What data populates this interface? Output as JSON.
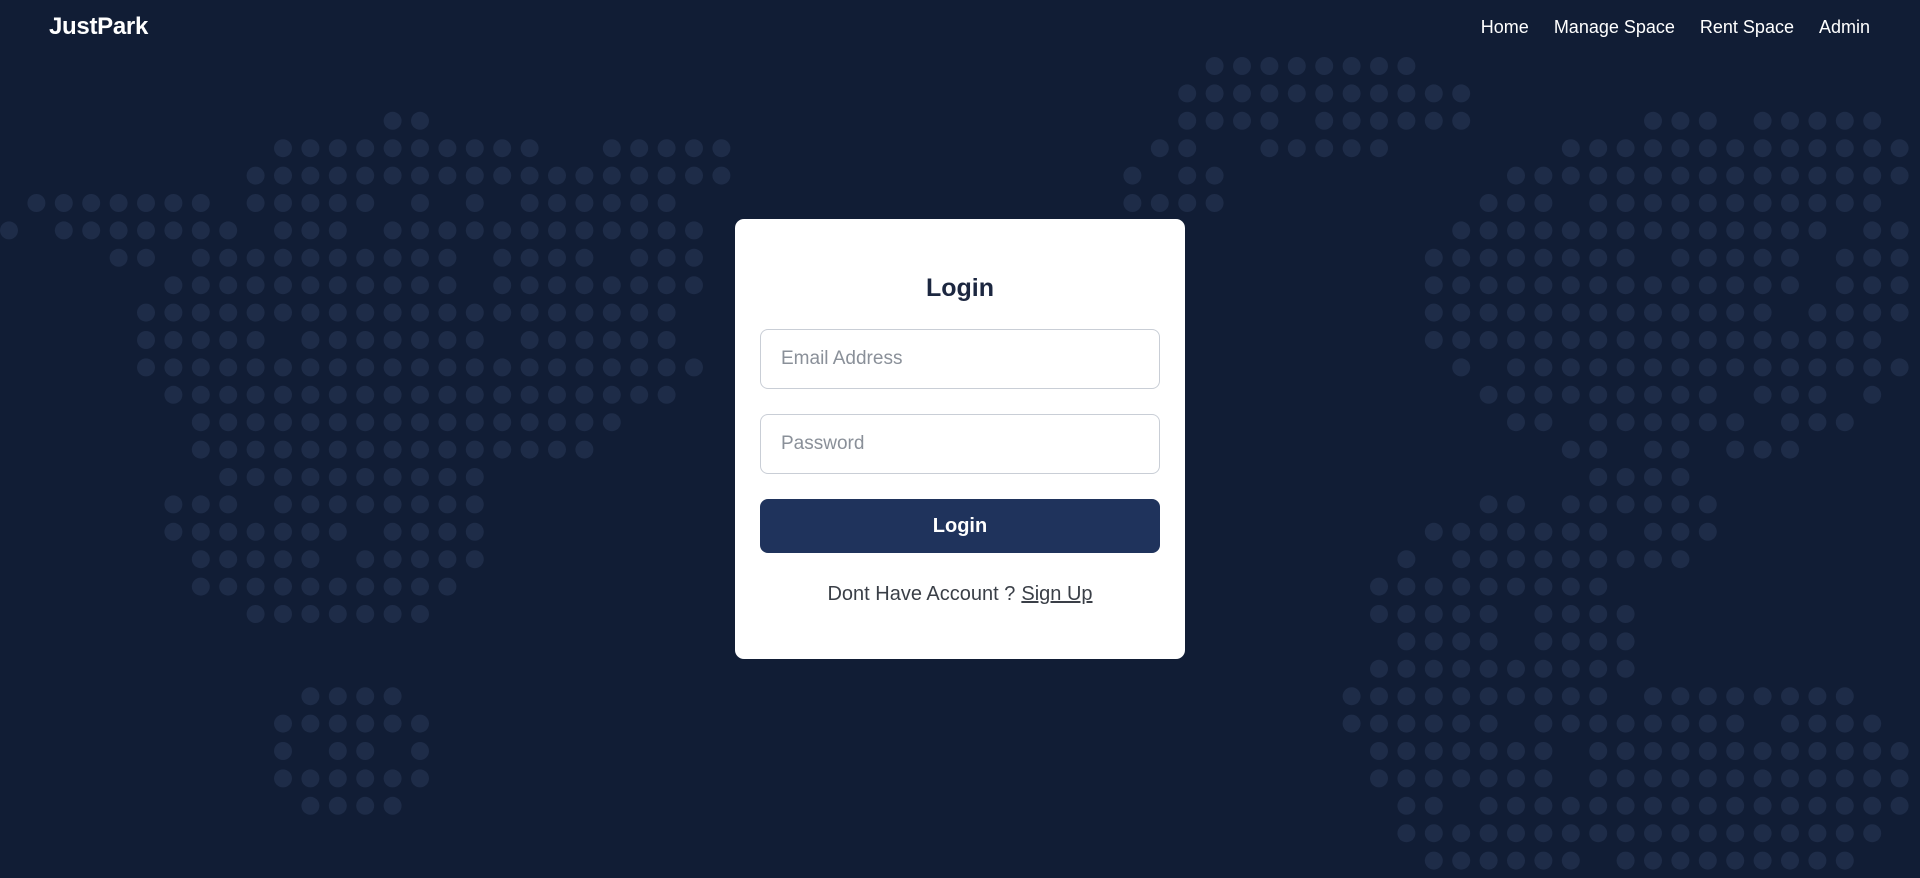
{
  "brand": "JustPark",
  "nav": {
    "items": [
      {
        "label": "Home"
      },
      {
        "label": "Manage Space"
      },
      {
        "label": "Rent Space"
      },
      {
        "label": "Admin"
      }
    ]
  },
  "login": {
    "title": "Login",
    "email_placeholder": "Email Address",
    "password_placeholder": "Password",
    "button_label": "Login",
    "signup_prompt": "Dont Have Account ?",
    "signup_link": "Sign Up"
  },
  "colors": {
    "background": "#111d35",
    "dot": "#1e2c48",
    "card": "#ffffff",
    "button": "#1f335c"
  }
}
